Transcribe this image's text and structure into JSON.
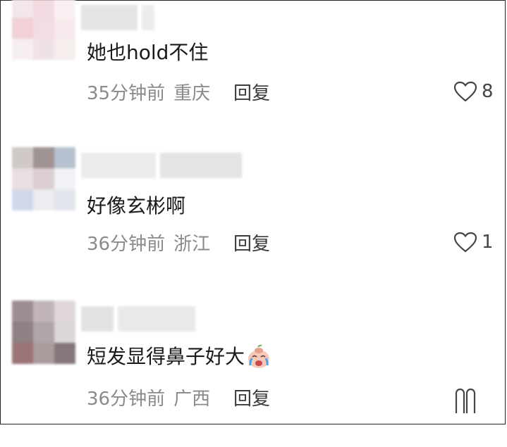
{
  "comments": [
    {
      "text": "她也hold不住",
      "time": "35分钟前",
      "location": "重庆",
      "reply_label": "回复",
      "like_count": "8",
      "avatar_colors": [
        "#f3e3e6",
        "#f2d6dc",
        "#f9eef0",
        "#efc9d0",
        "#f0d8dd",
        "#f7e8ea",
        "#f6ecee",
        "#ecdde0",
        "#f5eaeb"
      ],
      "username_colors": [
        "#e4e4e4",
        "#ececec"
      ]
    },
    {
      "text": "好像玄彬啊",
      "time": "36分钟前",
      "location": "浙江",
      "reply_label": "回复",
      "like_count": "1",
      "avatar_colors": [
        "#c8c0bf",
        "#8f8281",
        "#aab6c6",
        "#e6d9dc",
        "#d8c6c9",
        "#eef0f5",
        "#c9d1e6",
        "#eaeaef",
        "#dfe2ec"
      ],
      "username_colors": [
        "#ebebeb",
        "#e4e4e4"
      ]
    },
    {
      "text": "短发显得鼻子好大",
      "emoji": "crying-face-emoji",
      "time": "36分钟前",
      "location": "广西",
      "reply_label": "回复",
      "like_count": "",
      "avatar_colors": [
        "#8d7a7d",
        "#b7a9ad",
        "#dcd0d3",
        "#7c6a6e",
        "#a2979a",
        "#d8d0d2",
        "#8a5c60",
        "#9d8a8d",
        "#6f5f63"
      ],
      "username_colors": [
        "#e2e2e2",
        "#e9e9e9"
      ]
    }
  ],
  "colors": {
    "text": "#1a1a1a",
    "meta": "#8a8a8a",
    "reply": "#3a3a3a"
  }
}
